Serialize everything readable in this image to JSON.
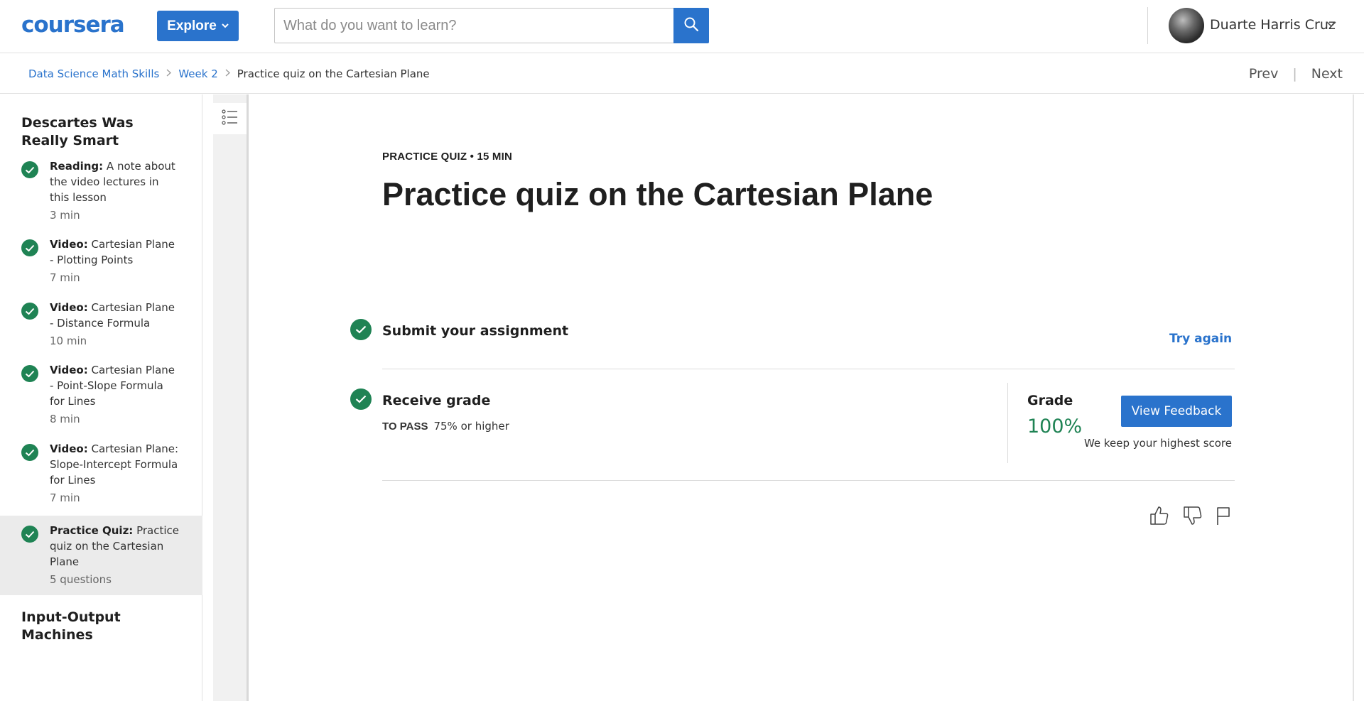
{
  "header": {
    "logo_text": "coursera",
    "explore_label": "Explore",
    "search_placeholder": "What do you want to learn?",
    "user_name": "Duarte Harris Cruz"
  },
  "breadcrumb": {
    "items": [
      "Data Science Math Skills",
      "Week 2"
    ],
    "current": "Practice quiz on the Cartesian Plane"
  },
  "nav": {
    "prev": "Prev",
    "next": "Next"
  },
  "sidebar": {
    "section_title": "Descartes Was Really Smart",
    "items": [
      {
        "type": "Reading:",
        "title": "A note about the video lectures in this lesson",
        "duration": "3 min",
        "completed": true
      },
      {
        "type": "Video:",
        "title": "Cartesian Plane - Plotting Points",
        "duration": "7 min",
        "completed": true
      },
      {
        "type": "Video:",
        "title": "Cartesian Plane - Distance Formula",
        "duration": "10 min",
        "completed": true
      },
      {
        "type": "Video:",
        "title": "Cartesian Plane - Point-Slope Formula for Lines",
        "duration": "8 min",
        "completed": true
      },
      {
        "type": "Video:",
        "title": "Cartesian Plane: Slope-Intercept Formula for Lines",
        "duration": "7 min",
        "completed": true
      },
      {
        "type": "Practice Quiz:",
        "title": "Practice quiz on the Cartesian Plane",
        "duration": "5 questions",
        "completed": true,
        "active": true
      }
    ],
    "next_section_title": "Input-Output Machines"
  },
  "main": {
    "eyebrow": "PRACTICE QUIZ • 15 MIN",
    "title": "Practice quiz on the Cartesian Plane",
    "submit": {
      "title": "Submit your assignment",
      "action": "Try again"
    },
    "receive": {
      "title": "Receive grade",
      "to_pass_label": "TO PASS",
      "to_pass_value": "75% or higher",
      "grade_label": "Grade",
      "grade_value": "100%",
      "view_feedback": "View Feedback",
      "keep_note": "We keep your highest score"
    }
  },
  "colors": {
    "brand": "#2a73cc",
    "success": "#1f8354"
  },
  "icons": [
    "search-icon",
    "chevron-down-icon",
    "list-toggle-icon",
    "checkmark-icon",
    "thumbs-up-icon",
    "thumbs-down-icon",
    "flag-icon"
  ]
}
